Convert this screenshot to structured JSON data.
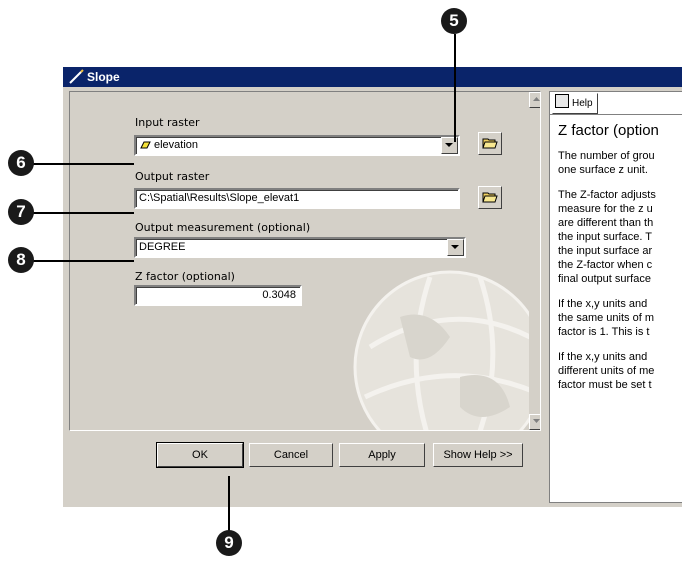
{
  "window": {
    "title": "Slope"
  },
  "form": {
    "input_raster": {
      "label": "Input raster",
      "value": "elevation"
    },
    "output_raster": {
      "label": "Output raster",
      "value": "C:\\Spatial\\Results\\Slope_elevat1"
    },
    "output_measurement": {
      "label": "Output measurement (optional)",
      "value": "DEGREE"
    },
    "z_factor": {
      "label": "Z factor (optional)",
      "value": "0.3048"
    }
  },
  "buttons": {
    "ok": "OK",
    "cancel": "Cancel",
    "apply": "Apply",
    "show_help": "Show Help >>"
  },
  "help": {
    "tab_label": "Help",
    "heading": "Z factor (option",
    "paragraphs": [
      "The number of grou\none surface z unit.",
      "The Z-factor adjusts\nmeasure for the z u\nare different than th\nthe input surface. T\nthe input surface ar\nthe Z-factor when c\nfinal output surface",
      "If the x,y units and\nthe same units of m\nfactor is 1. This is t",
      "If the x,y units and\ndifferent units of me\nfactor must be set t"
    ]
  },
  "callouts": [
    "5",
    "6",
    "7",
    "8",
    "9"
  ],
  "colors": {
    "titlebar": "#0a246a",
    "dialog": "#d4d0c8",
    "callout": "#1a1a1a"
  },
  "icons": [
    "slope-tool-icon",
    "raster-layer-icon",
    "folder-open-icon",
    "help-tab-icon",
    "globe-watermark-icon"
  ]
}
